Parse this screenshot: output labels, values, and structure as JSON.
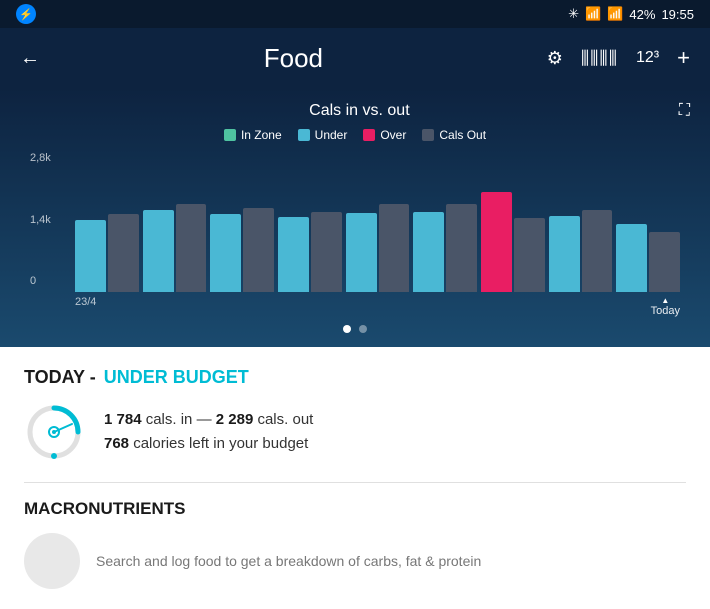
{
  "statusBar": {
    "battery": "42%",
    "time": "19:55",
    "bluetooth": "⚡",
    "wifi": "WiFi",
    "signal": "▲"
  },
  "header": {
    "back": "←",
    "title": "Food",
    "gear": "⚙",
    "barcode": "|||",
    "numbers": "12³",
    "plus": "+"
  },
  "chart": {
    "title": "Cals in vs. out",
    "expand": "⛶",
    "legend": [
      {
        "label": "In Zone",
        "color": "#4fc3a1"
      },
      {
        "label": "Under",
        "color": "#4ab8d4"
      },
      {
        "label": "Over",
        "color": "#e91e63"
      },
      {
        "label": "Cals Out",
        "color": "#4a5568"
      }
    ],
    "yLabels": [
      "2,8k",
      "1,4k",
      "0"
    ],
    "bars": [
      {
        "in": 65,
        "out": 70,
        "type": "under"
      },
      {
        "in": 75,
        "out": 82,
        "type": "under"
      },
      {
        "in": 70,
        "out": 78,
        "type": "under"
      },
      {
        "in": 68,
        "out": 74,
        "type": "under"
      },
      {
        "in": 72,
        "out": 80,
        "type": "under"
      },
      {
        "in": 74,
        "out": 82,
        "type": "under"
      },
      {
        "in": 90,
        "out": 68,
        "type": "over"
      },
      {
        "in": 70,
        "out": 76,
        "type": "under"
      },
      {
        "in": 62,
        "out": 56,
        "type": "under"
      }
    ],
    "dateStart": "23/4",
    "dateEnd": "Today"
  },
  "summary": {
    "todayLabel": "TODAY -",
    "budgetStatus": "UNDER BUDGET",
    "calsIn": "1 784",
    "calsOut": "2 289",
    "calsLeft": "768",
    "calsInLabel": "cals. in —",
    "calsOutLabel": "cals. out",
    "budgetLabel": "calories left in your budget"
  },
  "macronutrients": {
    "title": "MACRONUTRIENTS",
    "placeholder": "Search and log food to get a breakdown of carbs, fat & protein"
  }
}
